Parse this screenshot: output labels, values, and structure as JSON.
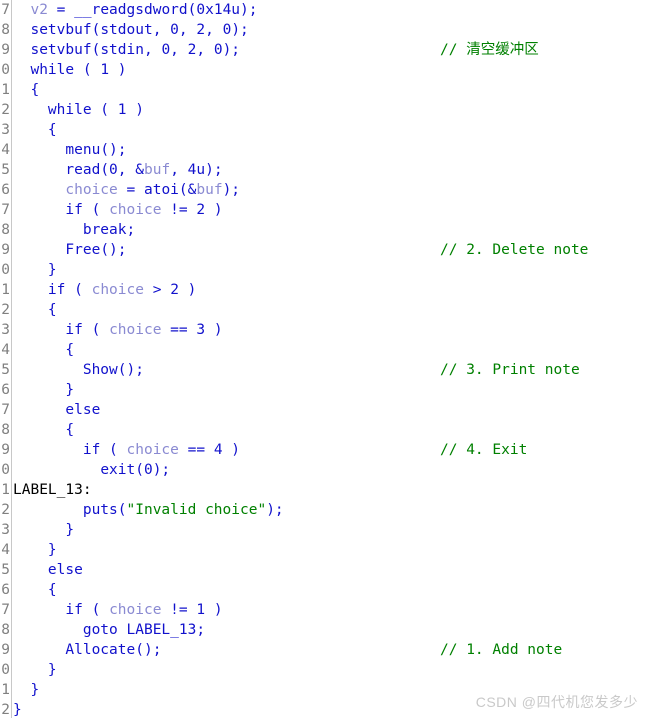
{
  "editor": {
    "name": "hex-rays-pseudocode-view",
    "colors": {
      "background": "#ffffff",
      "gutter_text": "#808080",
      "gutter_border": "#c8c8c8",
      "keyword": "#1111cc",
      "function": "#1111cc",
      "variable": "#8a8ad2",
      "number": "#1111cc",
      "string": "#008000",
      "comment": "#008000",
      "label": "#000000",
      "watermark": "#c9c9c9"
    },
    "line_numbers": [
      "7",
      "8",
      "9",
      "0",
      "1",
      "2",
      "3",
      "4",
      "5",
      "6",
      "7",
      "8",
      "9",
      "0",
      "1",
      "2",
      "3",
      "4",
      "5",
      "6",
      "7",
      "8",
      "9",
      "0",
      "1",
      "2",
      "3",
      "4",
      "5",
      "6",
      "7",
      "8",
      "9",
      "0",
      "1",
      "2"
    ],
    "lines": [
      {
        "code": "  v2 = __readgsdword(0x14u);",
        "tokens": [
          {
            "text": "  ",
            "cls": "t-plain"
          },
          {
            "text": "v2",
            "cls": "t-var"
          },
          {
            "text": " = ",
            "cls": "t-punct"
          },
          {
            "text": "__readgsdword",
            "cls": "t-func"
          },
          {
            "text": "(",
            "cls": "t-punct"
          },
          {
            "text": "0x14u",
            "cls": "t-num"
          },
          {
            "text": ");",
            "cls": "t-punct"
          }
        ],
        "comment": ""
      },
      {
        "code": "  setvbuf(stdout, 0, 2, 0);",
        "tokens": [
          {
            "text": "  ",
            "cls": "t-plain"
          },
          {
            "text": "setvbuf",
            "cls": "t-func"
          },
          {
            "text": "(",
            "cls": "t-punct"
          },
          {
            "text": "stdout",
            "cls": "t-kw"
          },
          {
            "text": ", ",
            "cls": "t-punct"
          },
          {
            "text": "0",
            "cls": "t-num"
          },
          {
            "text": ", ",
            "cls": "t-punct"
          },
          {
            "text": "2",
            "cls": "t-num"
          },
          {
            "text": ", ",
            "cls": "t-punct"
          },
          {
            "text": "0",
            "cls": "t-num"
          },
          {
            "text": ");",
            "cls": "t-punct"
          }
        ],
        "comment": ""
      },
      {
        "code": "  setvbuf(stdin, 0, 2, 0);",
        "tokens": [
          {
            "text": "  ",
            "cls": "t-plain"
          },
          {
            "text": "setvbuf",
            "cls": "t-func"
          },
          {
            "text": "(",
            "cls": "t-punct"
          },
          {
            "text": "stdin",
            "cls": "t-kw"
          },
          {
            "text": ", ",
            "cls": "t-punct"
          },
          {
            "text": "0",
            "cls": "t-num"
          },
          {
            "text": ", ",
            "cls": "t-punct"
          },
          {
            "text": "2",
            "cls": "t-num"
          },
          {
            "text": ", ",
            "cls": "t-punct"
          },
          {
            "text": "0",
            "cls": "t-num"
          },
          {
            "text": ");",
            "cls": "t-punct"
          }
        ],
        "comment": "// 清空缓冲区"
      },
      {
        "code": "  while ( 1 )",
        "tokens": [
          {
            "text": "  ",
            "cls": "t-plain"
          },
          {
            "text": "while",
            "cls": "t-kw"
          },
          {
            "text": " ( ",
            "cls": "t-punct"
          },
          {
            "text": "1",
            "cls": "t-num"
          },
          {
            "text": " )",
            "cls": "t-punct"
          }
        ],
        "comment": ""
      },
      {
        "code": "  {",
        "tokens": [
          {
            "text": "  {",
            "cls": "t-punct"
          }
        ],
        "comment": ""
      },
      {
        "code": "    while ( 1 )",
        "tokens": [
          {
            "text": "    ",
            "cls": "t-plain"
          },
          {
            "text": "while",
            "cls": "t-kw"
          },
          {
            "text": " ( ",
            "cls": "t-punct"
          },
          {
            "text": "1",
            "cls": "t-num"
          },
          {
            "text": " )",
            "cls": "t-punct"
          }
        ],
        "comment": ""
      },
      {
        "code": "    {",
        "tokens": [
          {
            "text": "    {",
            "cls": "t-punct"
          }
        ],
        "comment": ""
      },
      {
        "code": "      menu();",
        "tokens": [
          {
            "text": "      ",
            "cls": "t-plain"
          },
          {
            "text": "menu",
            "cls": "t-func"
          },
          {
            "text": "();",
            "cls": "t-punct"
          }
        ],
        "comment": ""
      },
      {
        "code": "      read(0, &buf, 4u);",
        "tokens": [
          {
            "text": "      ",
            "cls": "t-plain"
          },
          {
            "text": "read",
            "cls": "t-func"
          },
          {
            "text": "(",
            "cls": "t-punct"
          },
          {
            "text": "0",
            "cls": "t-num"
          },
          {
            "text": ", &",
            "cls": "t-punct"
          },
          {
            "text": "buf",
            "cls": "t-var"
          },
          {
            "text": ", ",
            "cls": "t-punct"
          },
          {
            "text": "4u",
            "cls": "t-num"
          },
          {
            "text": ");",
            "cls": "t-punct"
          }
        ],
        "comment": ""
      },
      {
        "code": "      choice = atoi(&buf);",
        "tokens": [
          {
            "text": "      ",
            "cls": "t-plain"
          },
          {
            "text": "choice",
            "cls": "t-var"
          },
          {
            "text": " = ",
            "cls": "t-punct"
          },
          {
            "text": "atoi",
            "cls": "t-func"
          },
          {
            "text": "(&",
            "cls": "t-punct"
          },
          {
            "text": "buf",
            "cls": "t-var"
          },
          {
            "text": ");",
            "cls": "t-punct"
          }
        ],
        "comment": ""
      },
      {
        "code": "      if ( choice != 2 )",
        "tokens": [
          {
            "text": "      ",
            "cls": "t-plain"
          },
          {
            "text": "if",
            "cls": "t-kw"
          },
          {
            "text": " ( ",
            "cls": "t-punct"
          },
          {
            "text": "choice",
            "cls": "t-var"
          },
          {
            "text": " != ",
            "cls": "t-punct"
          },
          {
            "text": "2",
            "cls": "t-num"
          },
          {
            "text": " )",
            "cls": "t-punct"
          }
        ],
        "comment": ""
      },
      {
        "code": "        break;",
        "tokens": [
          {
            "text": "        ",
            "cls": "t-plain"
          },
          {
            "text": "break",
            "cls": "t-kw"
          },
          {
            "text": ";",
            "cls": "t-punct"
          }
        ],
        "comment": ""
      },
      {
        "code": "      Free();",
        "tokens": [
          {
            "text": "      ",
            "cls": "t-plain"
          },
          {
            "text": "Free",
            "cls": "t-func"
          },
          {
            "text": "();",
            "cls": "t-punct"
          }
        ],
        "comment": "// 2. Delete note"
      },
      {
        "code": "    }",
        "tokens": [
          {
            "text": "    }",
            "cls": "t-punct"
          }
        ],
        "comment": ""
      },
      {
        "code": "    if ( choice > 2 )",
        "tokens": [
          {
            "text": "    ",
            "cls": "t-plain"
          },
          {
            "text": "if",
            "cls": "t-kw"
          },
          {
            "text": " ( ",
            "cls": "t-punct"
          },
          {
            "text": "choice",
            "cls": "t-var"
          },
          {
            "text": " > ",
            "cls": "t-punct"
          },
          {
            "text": "2",
            "cls": "t-num"
          },
          {
            "text": " )",
            "cls": "t-punct"
          }
        ],
        "comment": ""
      },
      {
        "code": "    {",
        "tokens": [
          {
            "text": "    {",
            "cls": "t-punct"
          }
        ],
        "comment": ""
      },
      {
        "code": "      if ( choice == 3 )",
        "tokens": [
          {
            "text": "      ",
            "cls": "t-plain"
          },
          {
            "text": "if",
            "cls": "t-kw"
          },
          {
            "text": " ( ",
            "cls": "t-punct"
          },
          {
            "text": "choice",
            "cls": "t-var"
          },
          {
            "text": " == ",
            "cls": "t-punct"
          },
          {
            "text": "3",
            "cls": "t-num"
          },
          {
            "text": " )",
            "cls": "t-punct"
          }
        ],
        "comment": ""
      },
      {
        "code": "      {",
        "tokens": [
          {
            "text": "      {",
            "cls": "t-punct"
          }
        ],
        "comment": ""
      },
      {
        "code": "        Show();",
        "tokens": [
          {
            "text": "        ",
            "cls": "t-plain"
          },
          {
            "text": "Show",
            "cls": "t-func"
          },
          {
            "text": "();",
            "cls": "t-punct"
          }
        ],
        "comment": "// 3. Print note"
      },
      {
        "code": "      }",
        "tokens": [
          {
            "text": "      }",
            "cls": "t-punct"
          }
        ],
        "comment": ""
      },
      {
        "code": "      else",
        "tokens": [
          {
            "text": "      ",
            "cls": "t-plain"
          },
          {
            "text": "else",
            "cls": "t-kw"
          }
        ],
        "comment": ""
      },
      {
        "code": "      {",
        "tokens": [
          {
            "text": "      {",
            "cls": "t-punct"
          }
        ],
        "comment": ""
      },
      {
        "code": "        if ( choice == 4 )",
        "tokens": [
          {
            "text": "        ",
            "cls": "t-plain"
          },
          {
            "text": "if",
            "cls": "t-kw"
          },
          {
            "text": " ( ",
            "cls": "t-punct"
          },
          {
            "text": "choice",
            "cls": "t-var"
          },
          {
            "text": " == ",
            "cls": "t-punct"
          },
          {
            "text": "4",
            "cls": "t-num"
          },
          {
            "text": " )",
            "cls": "t-punct"
          }
        ],
        "comment": "// 4. Exit"
      },
      {
        "code": "          exit(0);",
        "tokens": [
          {
            "text": "          ",
            "cls": "t-plain"
          },
          {
            "text": "exit",
            "cls": "t-func"
          },
          {
            "text": "(",
            "cls": "t-punct"
          },
          {
            "text": "0",
            "cls": "t-num"
          },
          {
            "text": ");",
            "cls": "t-punct"
          }
        ],
        "comment": ""
      },
      {
        "code": "LABEL_13:",
        "tokens": [
          {
            "text": "LABEL_13:",
            "cls": "t-label"
          }
        ],
        "comment": ""
      },
      {
        "code": "        puts(\"Invalid choice\");",
        "tokens": [
          {
            "text": "        ",
            "cls": "t-plain"
          },
          {
            "text": "puts",
            "cls": "t-func"
          },
          {
            "text": "(",
            "cls": "t-punct"
          },
          {
            "text": "\"Invalid choice\"",
            "cls": "t-str"
          },
          {
            "text": ");",
            "cls": "t-punct"
          }
        ],
        "comment": ""
      },
      {
        "code": "      }",
        "tokens": [
          {
            "text": "      }",
            "cls": "t-punct"
          }
        ],
        "comment": ""
      },
      {
        "code": "    }",
        "tokens": [
          {
            "text": "    }",
            "cls": "t-punct"
          }
        ],
        "comment": ""
      },
      {
        "code": "    else",
        "tokens": [
          {
            "text": "    ",
            "cls": "t-plain"
          },
          {
            "text": "else",
            "cls": "t-kw"
          }
        ],
        "comment": ""
      },
      {
        "code": "    {",
        "tokens": [
          {
            "text": "    {",
            "cls": "t-punct"
          }
        ],
        "comment": ""
      },
      {
        "code": "      if ( choice != 1 )",
        "tokens": [
          {
            "text": "      ",
            "cls": "t-plain"
          },
          {
            "text": "if",
            "cls": "t-kw"
          },
          {
            "text": " ( ",
            "cls": "t-punct"
          },
          {
            "text": "choice",
            "cls": "t-var"
          },
          {
            "text": " != ",
            "cls": "t-punct"
          },
          {
            "text": "1",
            "cls": "t-num"
          },
          {
            "text": " )",
            "cls": "t-punct"
          }
        ],
        "comment": ""
      },
      {
        "code": "        goto LABEL_13;",
        "tokens": [
          {
            "text": "        ",
            "cls": "t-plain"
          },
          {
            "text": "goto",
            "cls": "t-kw"
          },
          {
            "text": " ",
            "cls": "t-plain"
          },
          {
            "text": "LABEL_13",
            "cls": "t-kw"
          },
          {
            "text": ";",
            "cls": "t-punct"
          }
        ],
        "comment": ""
      },
      {
        "code": "      Allocate();",
        "tokens": [
          {
            "text": "      ",
            "cls": "t-plain"
          },
          {
            "text": "Allocate",
            "cls": "t-func"
          },
          {
            "text": "();",
            "cls": "t-punct"
          }
        ],
        "comment": "// 1. Add note"
      },
      {
        "code": "    }",
        "tokens": [
          {
            "text": "    }",
            "cls": "t-punct"
          }
        ],
        "comment": ""
      },
      {
        "code": "  }",
        "tokens": [
          {
            "text": "  }",
            "cls": "t-punct"
          }
        ],
        "comment": ""
      },
      {
        "code": "}",
        "tokens": [
          {
            "text": "}",
            "cls": "t-punct"
          }
        ],
        "comment": ""
      }
    ]
  },
  "watermark": {
    "text": "CSDN @四代机您发多少"
  }
}
